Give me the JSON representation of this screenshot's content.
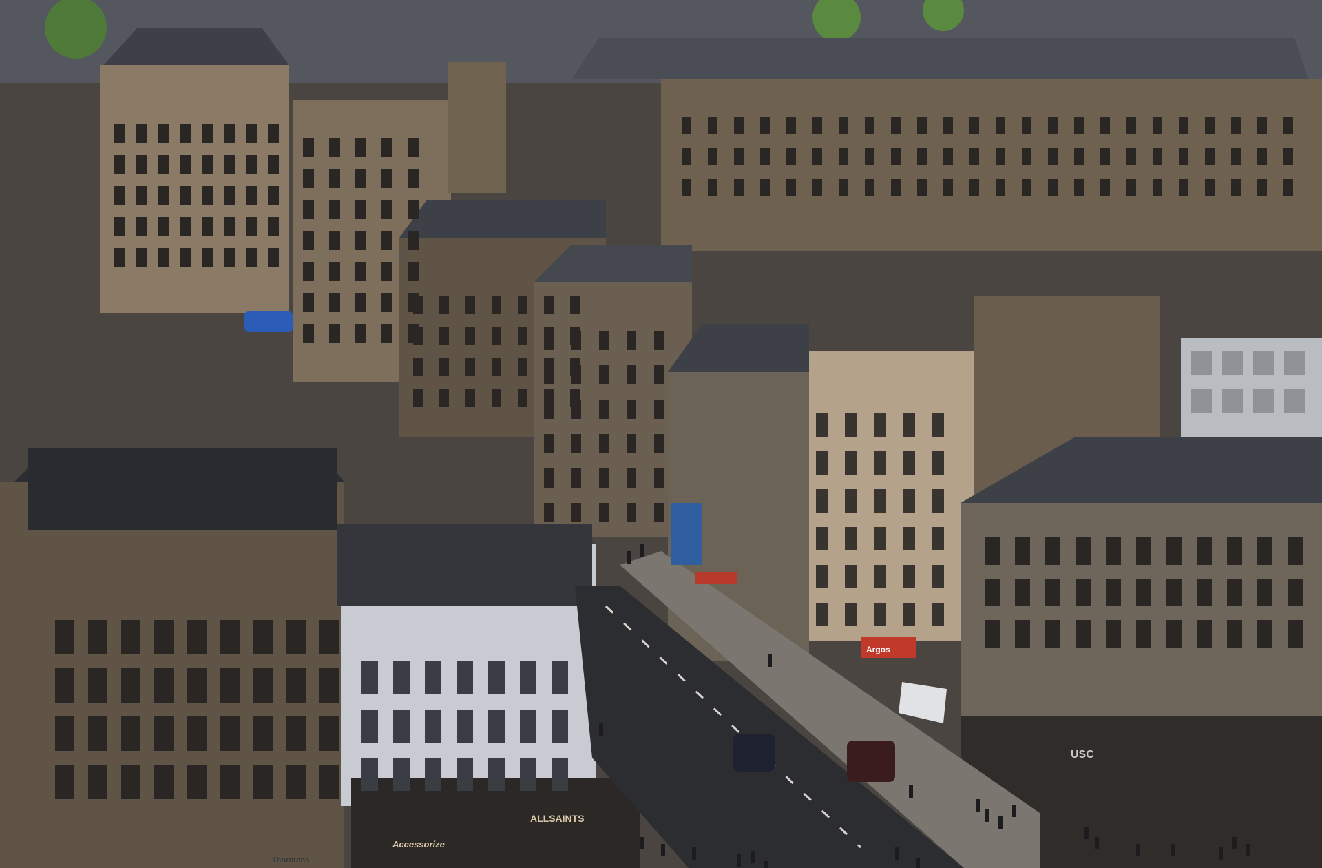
{
  "scene": {
    "description_kind": "aerial city street photograph",
    "colors": {
      "sky_shadow": "#2f2c29",
      "sandstone": "#8a7a66",
      "sandstone_light": "#b4a38a",
      "sandstone_dark": "#5f5446",
      "slate_roof": "#3d4047",
      "slate_roof_light": "#6a6e76",
      "white_building": "#c9cbd2",
      "road": "#2c2d30",
      "pavement": "#7c7670",
      "window": "#2a2624",
      "window_frame": "#d8d4cc",
      "red_sign": "#c0392b",
      "blue_shopfront": "#2f5f9e",
      "tree": "#4f7a3a"
    }
  },
  "signs": {
    "allsaints": "ALLSAINTS",
    "accessorize": "Accessorize",
    "thorntons": "Thorntons",
    "usc": "USC",
    "argos": "Argos"
  }
}
